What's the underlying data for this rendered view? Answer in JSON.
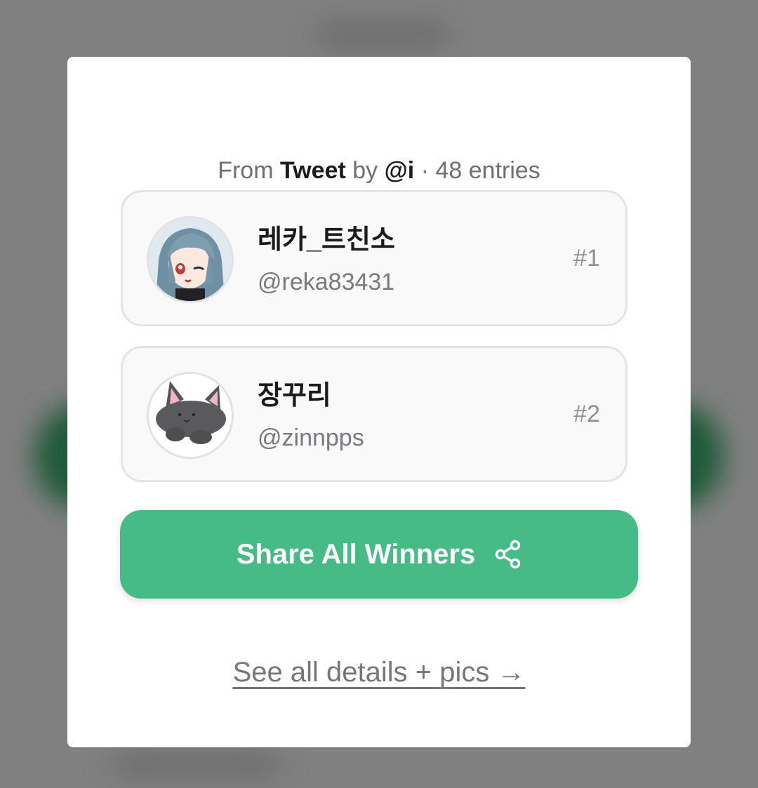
{
  "source": {
    "prefix": "From",
    "platform": "Tweet",
    "by_label": "by",
    "author": "@i",
    "separator": "·",
    "entries": "48 entries"
  },
  "winners": [
    {
      "name": "레카_트친소",
      "handle": "@reka83431",
      "rank": "#1",
      "avatar_icon": "anime-girl-avatar"
    },
    {
      "name": "장꾸리",
      "handle": "@zinnpps",
      "rank": "#2",
      "avatar_icon": "gray-cat-avatar"
    }
  ],
  "share_button": {
    "label": "Share All Winners",
    "icon": "share-icon"
  },
  "details_link": {
    "label": "See all details + pics →"
  },
  "colors": {
    "accent": "#46bb85",
    "overlay": "#808080",
    "card_bg": "#f9f9fa",
    "card_border": "#e4e4e6"
  }
}
